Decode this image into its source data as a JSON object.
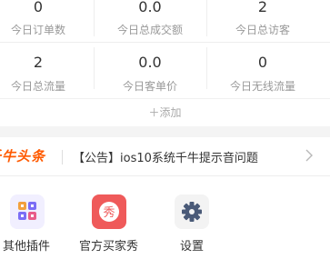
{
  "stats": [
    {
      "value": "0",
      "label": "今日订单数"
    },
    {
      "value": "0.0",
      "label": "今日总成交额"
    },
    {
      "value": "2",
      "label": "今日总访客"
    },
    {
      "value": "2",
      "label": "今日总流量"
    },
    {
      "value": "0.0",
      "label": "今日客单价"
    },
    {
      "value": "0",
      "label": "今日无线流量"
    }
  ],
  "add_label": "＋添加",
  "notice": {
    "brand": "千牛头条",
    "text": "【公告】ios10系统千牛提示音问题"
  },
  "apps": [
    {
      "name": "其他插件",
      "icon": "plugins-grid-icon"
    },
    {
      "name": "官方买家秀",
      "icon": "buyer-show-icon",
      "glyph": "秀"
    },
    {
      "name": "设置",
      "icon": "gear-icon"
    }
  ],
  "colors": {
    "brand_orange": "#ff5a00",
    "buyer_show_red": "#ef5a5a",
    "settings_icon": "#4a5a78"
  }
}
